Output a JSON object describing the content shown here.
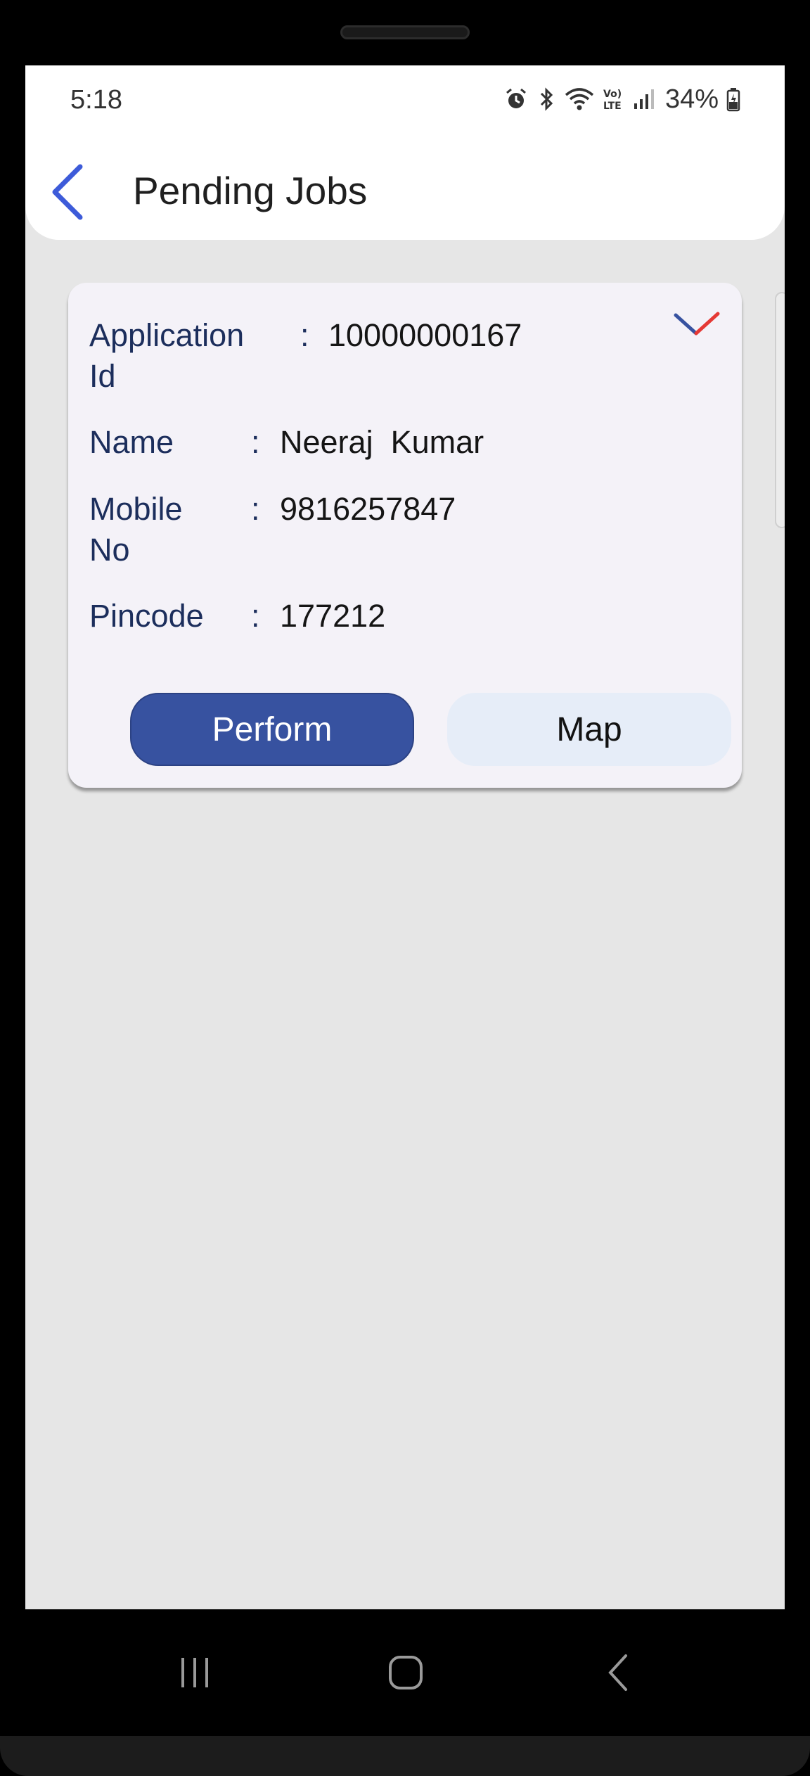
{
  "status_bar": {
    "time": "5:18",
    "battery": "34%",
    "icons": [
      "alarm-icon",
      "bluetooth-icon",
      "wifi-icon",
      "volte-icon",
      "signal-icon",
      "battery-icon"
    ]
  },
  "header": {
    "title": "Pending Jobs",
    "back_icon": "back-arrow-icon"
  },
  "job_card": {
    "fields": [
      {
        "label": "Application Id",
        "value": "10000000167"
      },
      {
        "label": "Name",
        "value": "Neeraj  Kumar"
      },
      {
        "label": "Mobile No",
        "value": "9816257847"
      },
      {
        "label": "Pincode",
        "value": "177212"
      }
    ],
    "separator": ":",
    "perform_label": "Perform",
    "map_label": "Map",
    "expand_icon": "chevron-down-icon"
  },
  "nav_bar": {
    "items": [
      "recents-icon",
      "home-icon",
      "back-icon"
    ]
  },
  "colors": {
    "accent": "#3752a0",
    "label": "#1c2e5c",
    "background": "#e6e6e6",
    "card": "#f4f2f8",
    "back_arrow": "#3d5bd9",
    "chevron_red": "#e53935"
  }
}
